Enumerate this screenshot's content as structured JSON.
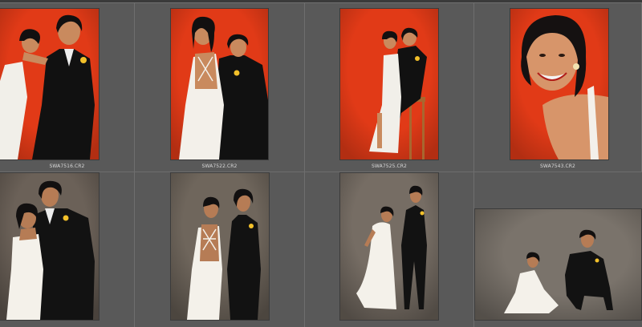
{
  "grid": {
    "columns": 4,
    "rows": [
      [
        {
          "filename": "SWA7516.CR2",
          "scene": "red",
          "pose": "couple-lean",
          "colors": {
            "bg": "#e13a17",
            "dress": "#f1efe9",
            "suit": "#111111",
            "skin": "#c98a5e",
            "hair": "#121010",
            "stool": "#8a4a22"
          }
        },
        {
          "filename": "SWA7522.CR2",
          "scene": "red",
          "pose": "couple-back",
          "colors": {
            "bg": "#e13a17",
            "dress": "#f3f0ea",
            "suit": "#111111",
            "skin": "#c98a5e",
            "hair": "#121010",
            "stool": "#8a4a22"
          }
        },
        {
          "filename": "SWA7525.CR2",
          "scene": "red",
          "pose": "couple-stool",
          "colors": {
            "bg": "#e13a17",
            "dress": "#f1efe9",
            "suit": "#111111",
            "skin": "#c98a5e",
            "hair": "#121010",
            "stool": "#a8672f"
          }
        },
        {
          "filename": "SWA7543.CR2",
          "scene": "red",
          "pose": "portrait-smile",
          "colors": {
            "bg": "#e13a17",
            "dress": "#f3f0ea",
            "suit": "#111111",
            "skin": "#d7956a",
            "hair": "#151111",
            "stool": "#8a4a22"
          }
        }
      ],
      [
        {
          "filename": "",
          "scene": "gray",
          "pose": "couple-embrace",
          "colors": {
            "bg": "#6b6158",
            "dress": "#f4f1ea",
            "suit": "#121212",
            "skin": "#b67c55",
            "hair": "#121010",
            "stool": "#6b4a2c"
          }
        },
        {
          "filename": "",
          "scene": "gray",
          "pose": "couple-apart",
          "colors": {
            "bg": "#6f665c",
            "dress": "#f4f1ea",
            "suit": "#121212",
            "skin": "#b67c55",
            "hair": "#121010",
            "stool": "#6b4a2c"
          }
        },
        {
          "filename": "",
          "scene": "gray",
          "pose": "couple-full",
          "colors": {
            "bg": "#766d64",
            "dress": "#f4f1ea",
            "suit": "#121212",
            "skin": "#b67c55",
            "hair": "#121010",
            "stool": "#6b4a2c"
          }
        },
        {
          "filename": "",
          "scene": "gray",
          "pose": "couple-crouch",
          "colors": {
            "bg": "#7a736b",
            "dress": "#f4f1ea",
            "suit": "#121212",
            "skin": "#b67c55",
            "hair": "#121010",
            "stool": "#6b4a2c"
          }
        }
      ]
    ]
  }
}
